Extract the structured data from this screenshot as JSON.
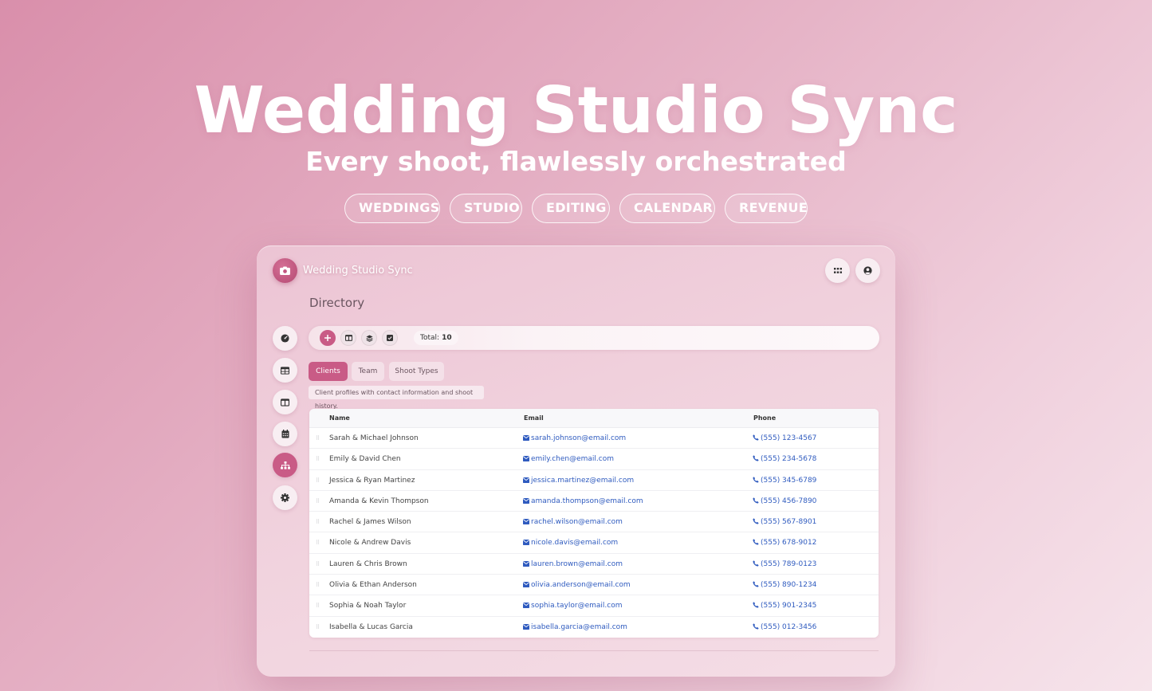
{
  "hero": {
    "title": "Wedding Studio Sync",
    "subtitle": "Every shoot, flawlessly orchestrated",
    "pills": [
      "WEDDINGS",
      "STUDIO",
      "EDITING",
      "CALENDAR",
      "REVENUE"
    ]
  },
  "app": {
    "title": "Wedding Studio Sync",
    "logo_icon": "camera-icon",
    "top_buttons": [
      "apps-grid-icon",
      "user-circle-icon"
    ],
    "page_heading": "Directory",
    "sidebar": [
      {
        "icon": "dashboard-gauge-icon",
        "active": false
      },
      {
        "icon": "table-icon",
        "active": false
      },
      {
        "icon": "columns-icon",
        "active": false
      },
      {
        "icon": "calendar-icon",
        "active": false
      },
      {
        "icon": "sitemap-icon",
        "active": true
      },
      {
        "icon": "gear-icon",
        "active": false
      }
    ],
    "toolbar": {
      "buttons": [
        "plus-icon",
        "columns-icon",
        "layers-icon",
        "check-square-icon"
      ],
      "total_label": "Total:",
      "total_value": "10"
    },
    "tabs": [
      {
        "label": "Clients",
        "active": true
      },
      {
        "label": "Team",
        "active": false
      },
      {
        "label": "Shoot Types",
        "active": false
      }
    ],
    "description": "Client profiles with contact information and shoot history.",
    "table": {
      "columns": [
        "Name",
        "Email",
        "Phone"
      ],
      "rows": [
        {
          "name": "Sarah & Michael Johnson",
          "email": "sarah.johnson@email.com",
          "phone": "(555) 123-4567"
        },
        {
          "name": "Emily & David Chen",
          "email": "emily.chen@email.com",
          "phone": "(555) 234-5678"
        },
        {
          "name": "Jessica & Ryan Martinez",
          "email": "jessica.martinez@email.com",
          "phone": "(555) 345-6789"
        },
        {
          "name": "Amanda & Kevin Thompson",
          "email": "amanda.thompson@email.com",
          "phone": "(555) 456-7890"
        },
        {
          "name": "Rachel & James Wilson",
          "email": "rachel.wilson@email.com",
          "phone": "(555) 567-8901"
        },
        {
          "name": "Nicole & Andrew Davis",
          "email": "nicole.davis@email.com",
          "phone": "(555) 678-9012"
        },
        {
          "name": "Lauren & Chris Brown",
          "email": "lauren.brown@email.com",
          "phone": "(555) 789-0123"
        },
        {
          "name": "Olivia & Ethan Anderson",
          "email": "olivia.anderson@email.com",
          "phone": "(555) 890-1234"
        },
        {
          "name": "Sophia & Noah Taylor",
          "email": "sophia.taylor@email.com",
          "phone": "(555) 901-2345"
        },
        {
          "name": "Isabella & Lucas Garcia",
          "email": "isabella.garcia@email.com",
          "phone": "(555) 012-3456"
        }
      ]
    }
  },
  "colors": {
    "accent": "#c95b86",
    "link": "#2f5bbf"
  }
}
